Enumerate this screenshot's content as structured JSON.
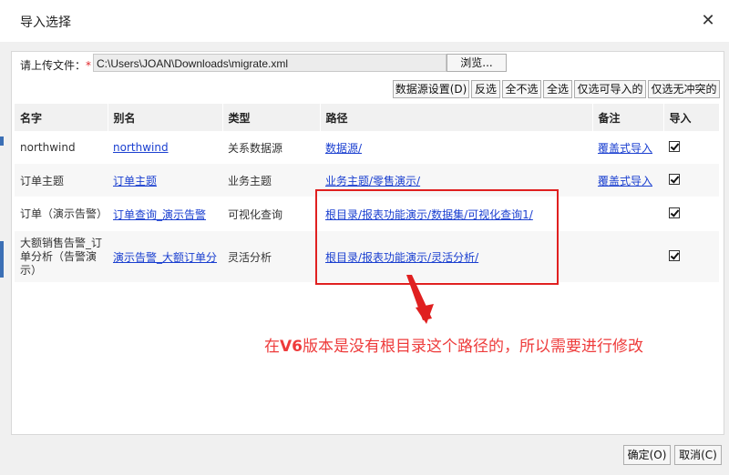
{
  "dialog": {
    "title": "导入选择",
    "close_icon": "close-icon"
  },
  "upload": {
    "label": "请上传文件：",
    "required_mark": "*",
    "file_path": "C:\\Users\\JOAN\\Downloads\\migrate.xml",
    "browse_label": "浏览..."
  },
  "toolbar": {
    "buttons": [
      "数据源设置(D)",
      "反选",
      "全不选",
      "全选",
      "仅选可导入的",
      "仅选无冲突的"
    ]
  },
  "table": {
    "columns": [
      "名字",
      "别名",
      "类型",
      "路径",
      "备注",
      "导入"
    ],
    "rows": [
      {
        "name": "northwind",
        "alias": "northwind",
        "type": "关系数据源",
        "path": "数据源/",
        "note": "覆盖式导入",
        "import": true
      },
      {
        "name": "订单主题",
        "alias": "订单主题",
        "type": "业务主题",
        "path": "业务主题/零售演示/",
        "note": "覆盖式导入",
        "import": true
      },
      {
        "name": "订单（演示告警）",
        "alias": "订单查询_演示告警",
        "type": "可视化查询",
        "path": "根目录/报表功能演示/数据集/可视化查询1/",
        "note": "",
        "import": true
      },
      {
        "name": "大额销售告警_订单分析（告警演示）",
        "alias": "演示告警_大额订单分",
        "type": "灵活分析",
        "path": "根目录/报表功能演示/灵活分析/",
        "note": "",
        "import": true
      }
    ]
  },
  "annotation": {
    "prefix": "在",
    "version": "V6",
    "suffix": "版本是没有根目录这个路径的，所以需要进行修改",
    "color": "#ee3b3b"
  },
  "footer": {
    "ok_label": "确定(O)",
    "cancel_label": "取消(C)"
  }
}
